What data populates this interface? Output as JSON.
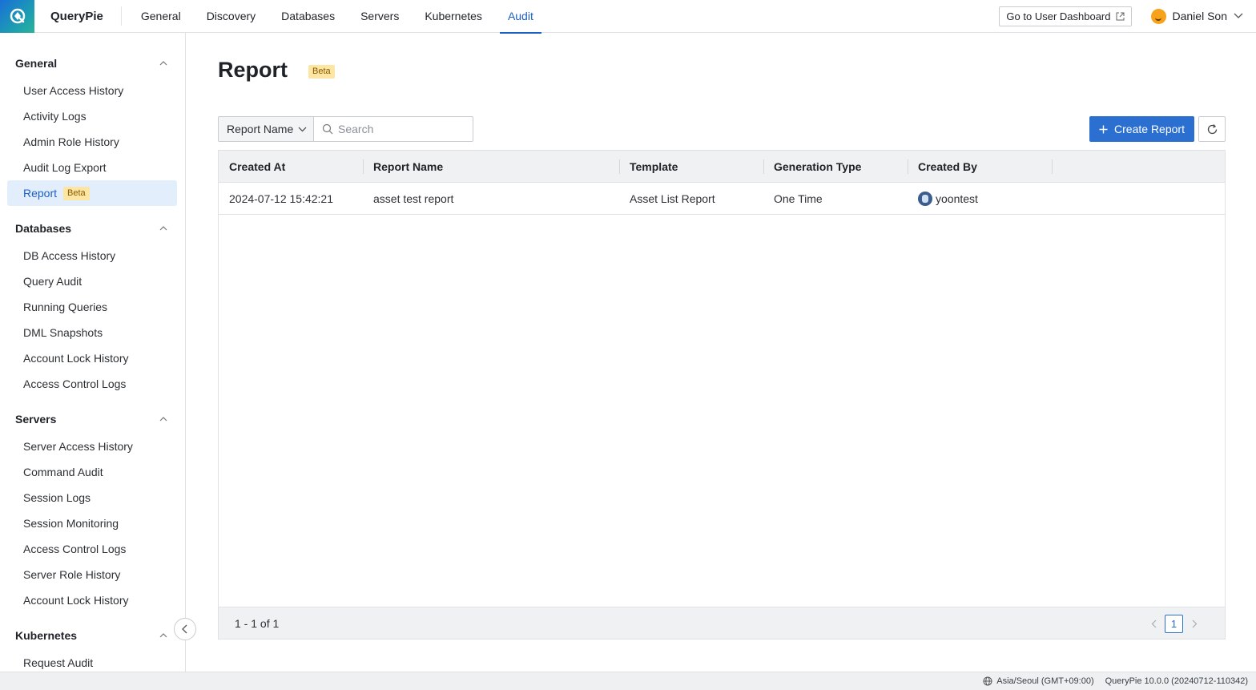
{
  "brand": "QueryPie",
  "nav": {
    "items": [
      {
        "label": "General"
      },
      {
        "label": "Discovery"
      },
      {
        "label": "Databases"
      },
      {
        "label": "Servers"
      },
      {
        "label": "Kubernetes"
      },
      {
        "label": "Audit"
      }
    ],
    "active": "Audit",
    "dashboard_button": "Go to User Dashboard",
    "user_name": "Daniel Son"
  },
  "sidebar": {
    "groups": [
      {
        "title": "General",
        "items": [
          "User Access History",
          "Activity Logs",
          "Admin Role History",
          "Audit Log Export",
          "Report"
        ]
      },
      {
        "title": "Databases",
        "items": [
          "DB Access History",
          "Query Audit",
          "Running Queries",
          "DML Snapshots",
          "Account Lock History",
          "Access Control Logs"
        ]
      },
      {
        "title": "Servers",
        "items": [
          "Server Access History",
          "Command Audit",
          "Session Logs",
          "Session Monitoring",
          "Access Control Logs",
          "Server Role History",
          "Account Lock History"
        ]
      },
      {
        "title": "Kubernetes",
        "items": [
          "Request Audit"
        ]
      }
    ],
    "active_item": "Report",
    "beta_label": "Beta"
  },
  "page": {
    "title": "Report",
    "beta_label": "Beta"
  },
  "toolbar": {
    "filter_select": "Report Name",
    "search_placeholder": "Search",
    "search_value": "",
    "create_button": "Create Report"
  },
  "table": {
    "columns": [
      "Created At",
      "Report Name",
      "Template",
      "Generation Type",
      "Created By"
    ],
    "rows": [
      {
        "created_at": "2024-07-12 15:42:21",
        "report_name": "asset test report",
        "template": "Asset List Report",
        "generation_type": "One Time",
        "created_by": "yoontest"
      }
    ],
    "range_text": "1 - 1 of 1",
    "current_page": "1"
  },
  "status_bar": {
    "timezone": "Asia/Seoul (GMT+09:00)",
    "version": "QueryPie 10.0.0 (20240712-110342)"
  },
  "colors": {
    "accent": "#2b6fd1",
    "active_nav": "#1d5fc4",
    "beta_bg": "#fde6a3",
    "sidebar_active_bg": "#e3eefc"
  },
  "icons": [
    "querypie-logo-icon",
    "external-link-icon",
    "chevron-down-icon",
    "chevron-up-icon",
    "chevron-left-icon",
    "search-icon",
    "plus-icon",
    "refresh-icon",
    "globe-icon"
  ]
}
